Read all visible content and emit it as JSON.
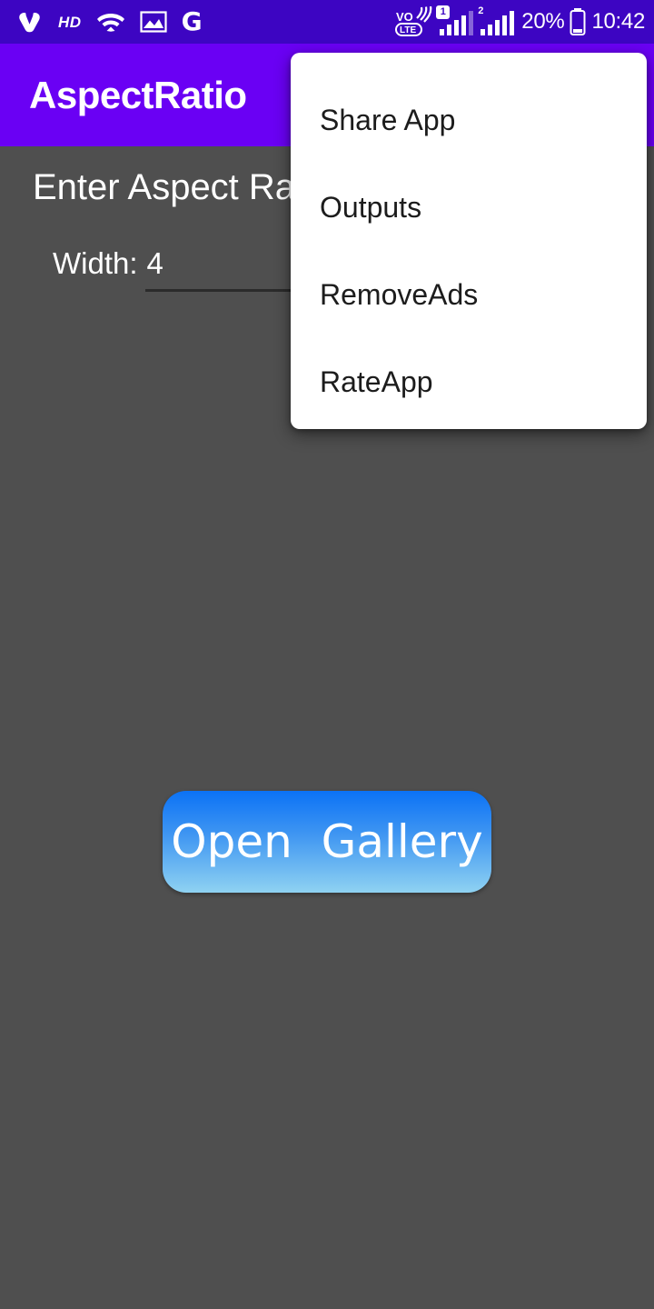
{
  "status_bar": {
    "left_icons": [
      {
        "name": "app-notification-icon",
        "glyph": "logo"
      },
      {
        "name": "hd-call-icon",
        "label": "HD"
      },
      {
        "name": "wifi-icon",
        "glyph": "wifi"
      },
      {
        "name": "screenshot-image-icon",
        "glyph": "image"
      },
      {
        "name": "google-icon",
        "label": "G"
      }
    ],
    "volte_label": "VoLTE",
    "sim1_badge": "1",
    "sim2_badge": "2",
    "battery_percent": "20%",
    "battery_icon": "battery-icon",
    "clock": "10:42",
    "background_color": "#3d05c2",
    "foreground_color": "#ffffff"
  },
  "app_bar": {
    "title": "AspectRatio",
    "background_color": "#6a00f4",
    "title_color": "#ffffff"
  },
  "main": {
    "heading": "Enter Aspect Ratio",
    "width_label": "Width:",
    "width_value": "4",
    "width_placeholder": "Width",
    "background_color": "#4f4f4f",
    "text_color": "#ffffff"
  },
  "gallery_button": {
    "label": "Open  Gallery",
    "gradient_top": "#0b72f5",
    "gradient_bottom": "#8fd2f2",
    "text_color": "#ffffff"
  },
  "popup_menu": {
    "background_color": "#ffffff",
    "text_color": "#1c1c1c",
    "items": [
      {
        "label": "Share App"
      },
      {
        "label": "Outputs"
      },
      {
        "label": "RemoveAds"
      },
      {
        "label": "RateApp"
      }
    ]
  }
}
